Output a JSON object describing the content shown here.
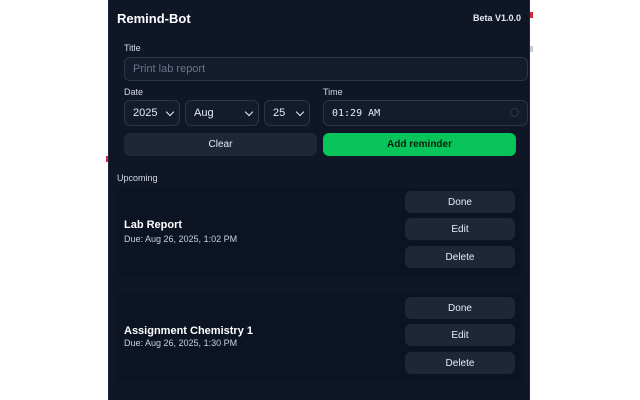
{
  "app": {
    "title": "Remind-Bot",
    "version": "Beta V1.0.0"
  },
  "form": {
    "title_label": "Title",
    "title_placeholder": "Print lab report",
    "date_label": "Date",
    "year": "2025",
    "month": "Aug",
    "day": "25",
    "time_label": "Time",
    "time_value": "01:29 AM",
    "clear_label": "Clear",
    "add_label": "Add reminder"
  },
  "upcoming": {
    "label": "Upcoming",
    "items": [
      {
        "title": "Lab Report",
        "due": "Due: Aug 26, 2025, 1:02 PM",
        "done_label": "Done",
        "edit_label": "Edit",
        "delete_label": "Delete"
      },
      {
        "title": "Assignment Chemistry 1",
        "due": "Due: Aug 26, 2025, 1:30 PM",
        "done_label": "Done",
        "edit_label": "Edit",
        "delete_label": "Delete"
      }
    ]
  },
  "colors": {
    "background": "#0f1626",
    "accent": "#08c45a",
    "button_dark": "#1e2738"
  }
}
